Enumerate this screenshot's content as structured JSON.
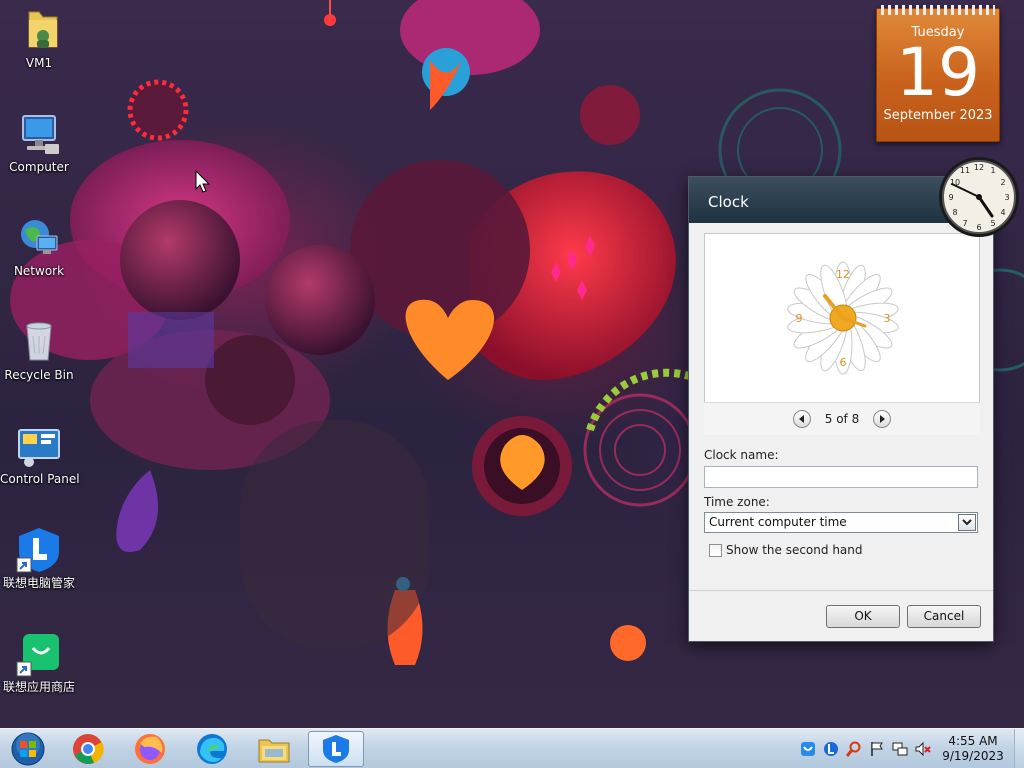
{
  "desktop": {
    "icons": [
      {
        "label": "VM1",
        "icon": "user-folder-icon"
      },
      {
        "label": "Computer",
        "icon": "computer-icon"
      },
      {
        "label": "Network",
        "icon": "network-globe-icon"
      },
      {
        "label": "Recycle Bin",
        "icon": "recycle-bin-icon"
      },
      {
        "label": "Control Panel",
        "icon": "control-panel-icon"
      },
      {
        "label": "联想电脑管家",
        "icon": "lenovo-pc-manager-icon"
      },
      {
        "label": "联想应用商店",
        "icon": "lenovo-app-store-icon"
      }
    ]
  },
  "calendar_gadget": {
    "weekday": "Tuesday",
    "day": "19",
    "month_year": "September 2023"
  },
  "dialog": {
    "title": "Clock",
    "pager_text": "5 of 8",
    "clock_name_label": "Clock name:",
    "clock_name_value": "",
    "time_zone_label": "Time zone:",
    "time_zone_value": "Current computer time",
    "second_hand_label": "Show the second hand",
    "second_hand_checked": false,
    "ok_label": "OK",
    "cancel_label": "Cancel",
    "clock_face_numbers": [
      "12",
      "3",
      "6",
      "9"
    ]
  },
  "taskbar": {
    "items": [
      "start-orb-icon",
      "chrome-icon",
      "firefox-icon",
      "edge-icon",
      "file-explorer-icon",
      "lenovo-manager-icon"
    ],
    "tray_icons": [
      "lenovo-shield-icon",
      "lenovo-l-icon",
      "search-icon",
      "flag-icon",
      "network-icon",
      "volume-muted-icon"
    ],
    "time": "4:55 AM",
    "date": "9/19/2023"
  },
  "colors": {
    "calendar_orange": "#c9621c",
    "dialog_title_bg": "#1f3241",
    "taskbar_bg": "#c2d4e6"
  }
}
